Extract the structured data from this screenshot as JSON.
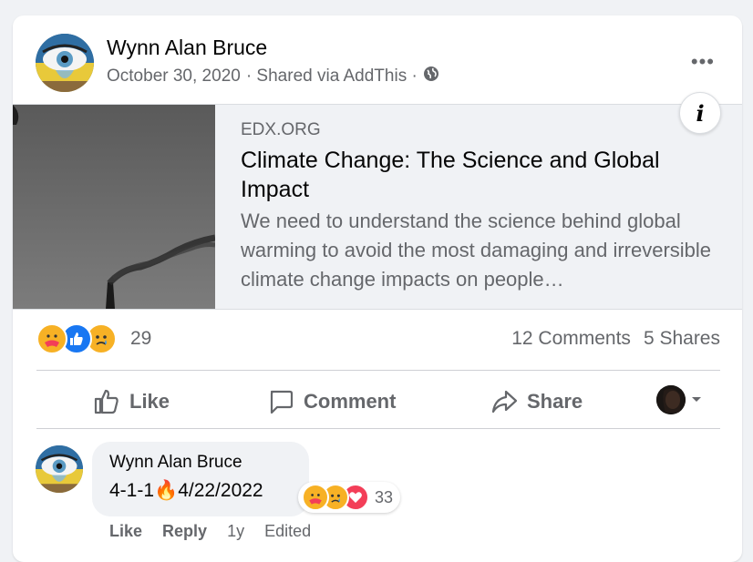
{
  "post": {
    "author": "Wynn Alan Bruce",
    "date": "October 30, 2020",
    "shared_via": "· Shared via AddThis ·",
    "privacy_icon": "globe-icon",
    "more_label": "•••"
  },
  "link_preview": {
    "domain": "EDX.ORG",
    "title": "Climate Change: The Science and Global Impact",
    "description": "We need to understand the science behind global warming to avoid the most damaging and irreversible climate change impacts on people…",
    "info_label": "i"
  },
  "stats": {
    "reactions": [
      "care",
      "like",
      "sad"
    ],
    "reaction_count": "29",
    "comments": "12 Comments",
    "shares": "5 Shares"
  },
  "actions": {
    "like": "Like",
    "comment": "Comment",
    "share": "Share"
  },
  "comment": {
    "author": "Wynn Alan Bruce",
    "text_before": "4-1-1",
    "emoji": "🔥",
    "text_after": "4/22/2022",
    "reactions": [
      "care",
      "sad",
      "love"
    ],
    "reaction_count": "33",
    "like_label": "Like",
    "reply_label": "Reply",
    "age": "1y",
    "edited": "Edited"
  },
  "colors": {
    "like_blue": "#1877f2",
    "care_yellow": "#f7b125",
    "love_red": "#f33e58",
    "meta_gray": "#65676b"
  }
}
